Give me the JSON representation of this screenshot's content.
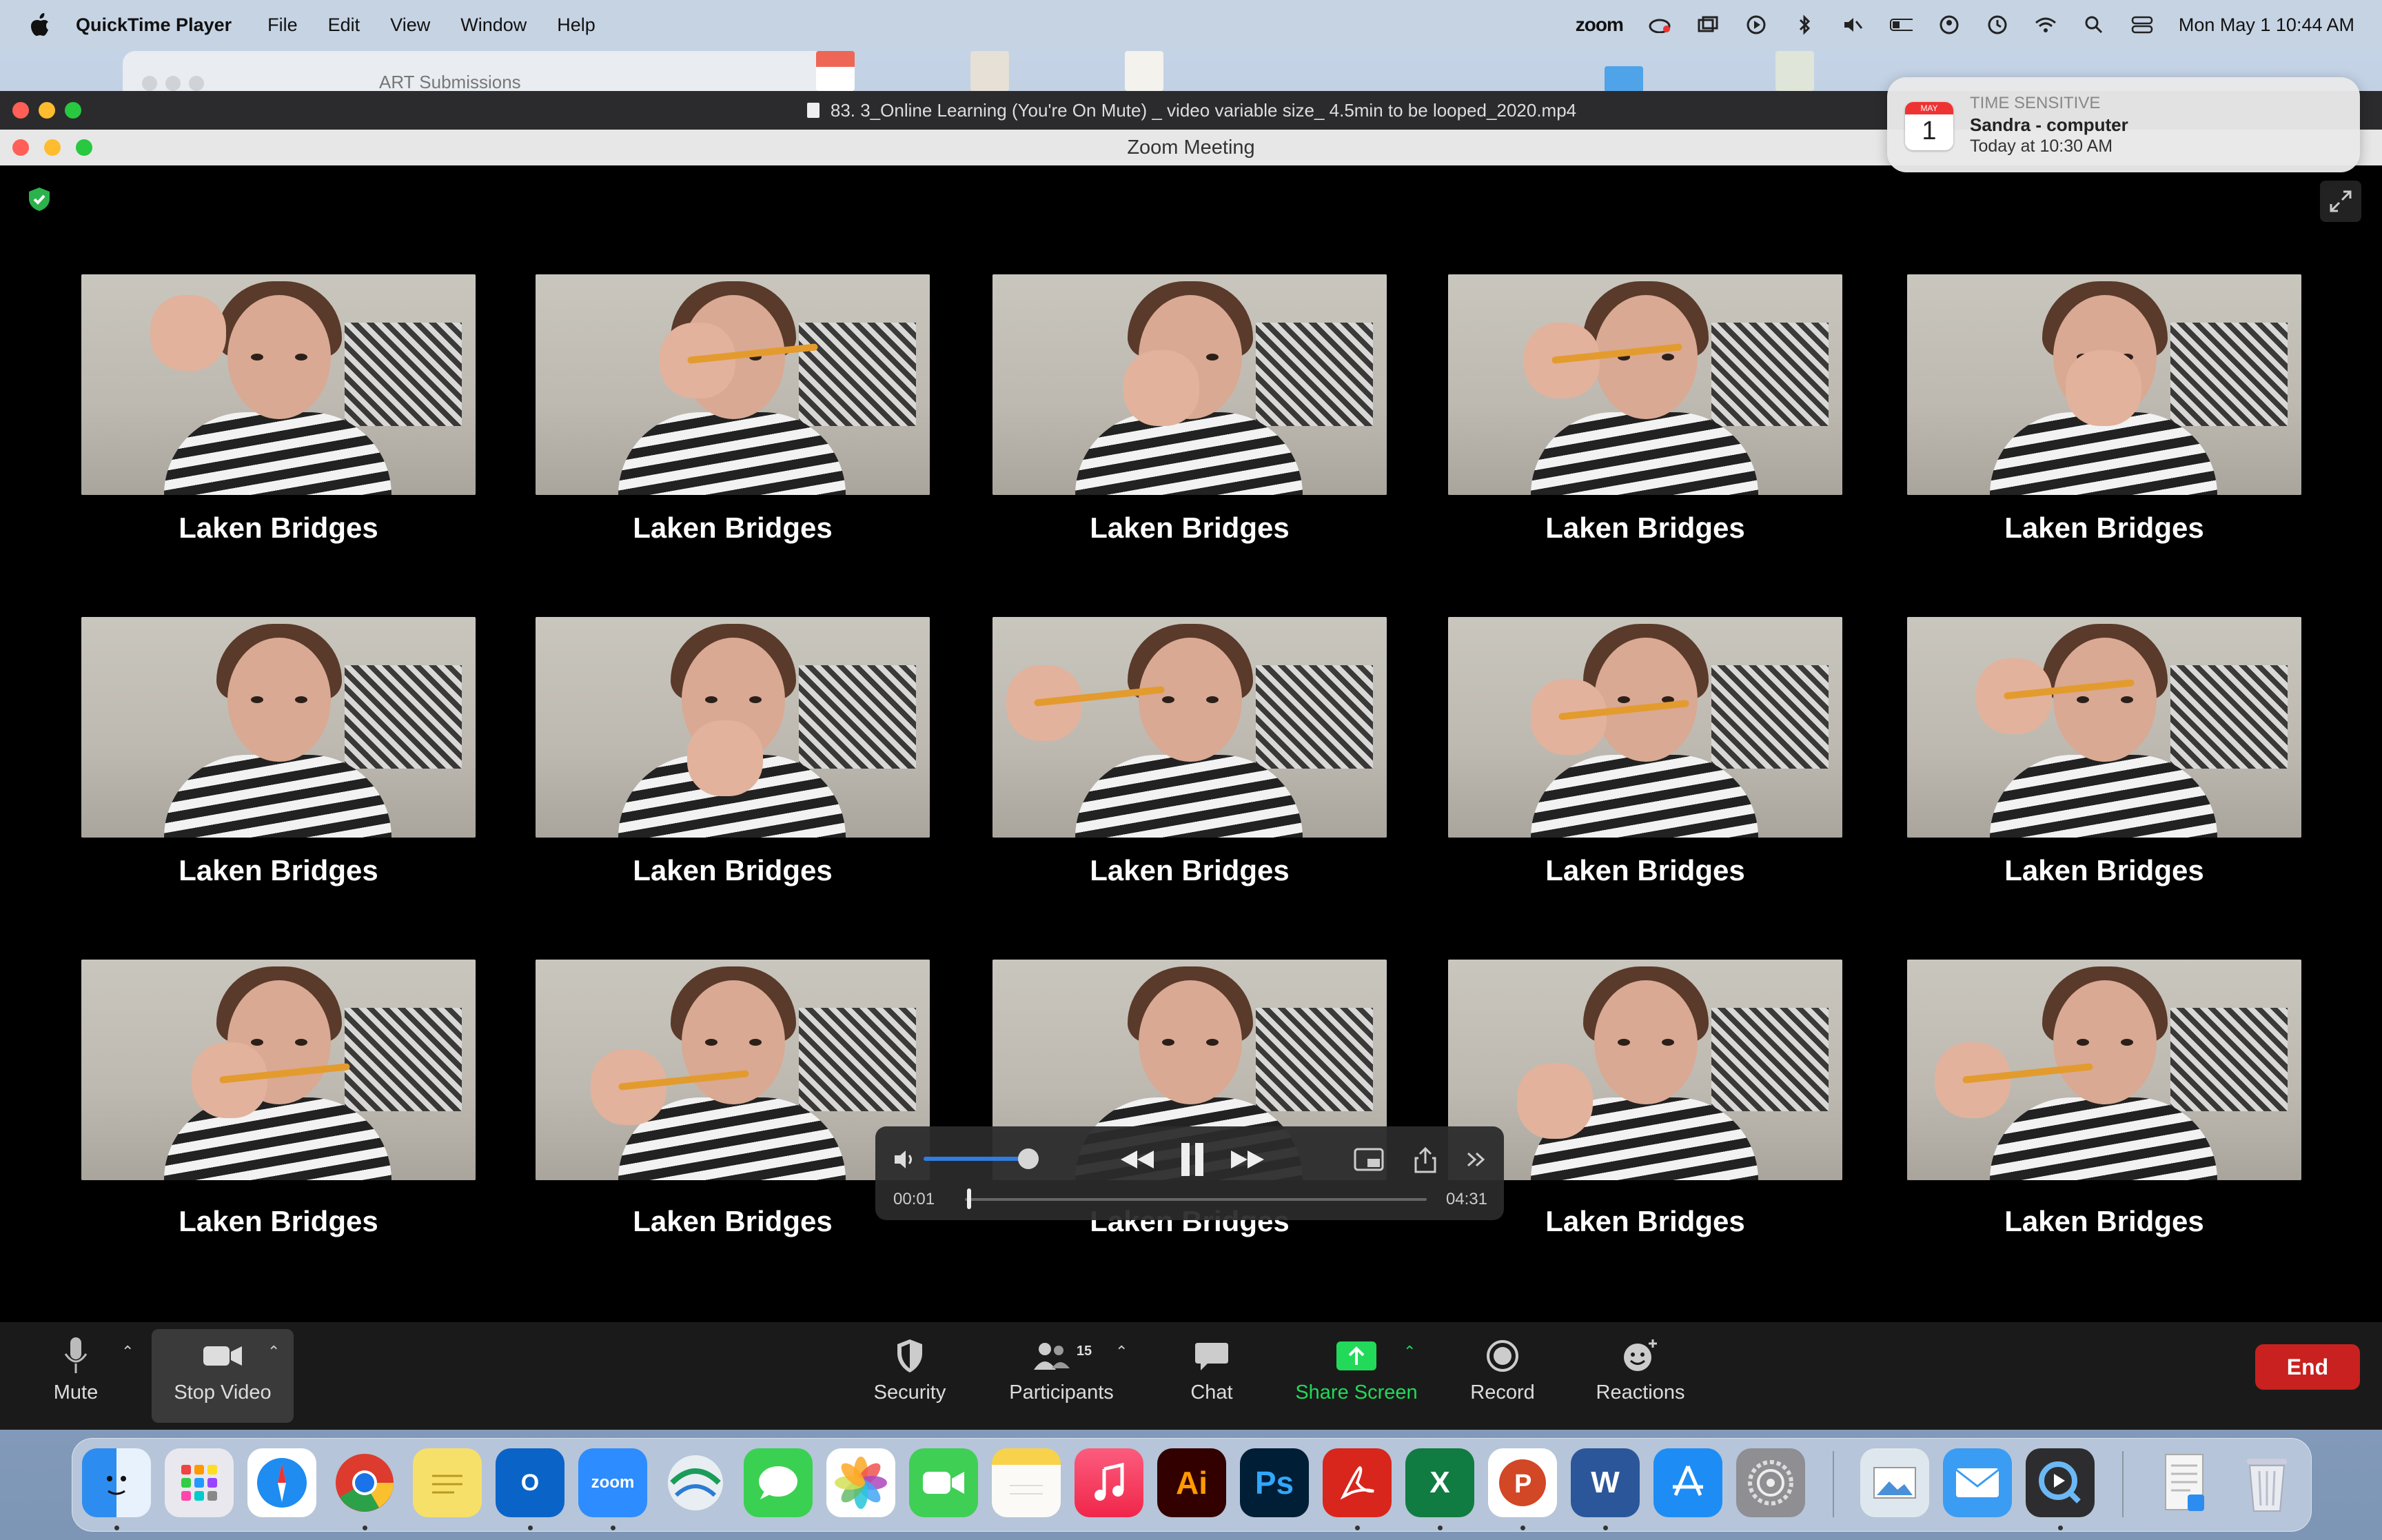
{
  "menubar": {
    "app_name": "QuickTime Player",
    "menus": [
      "File",
      "Edit",
      "View",
      "Window",
      "Help"
    ],
    "zoom_label": "zoom",
    "datetime": "Mon May 1  10:44 AM"
  },
  "background_window": {
    "title": "ART Submissions"
  },
  "quicktime": {
    "file_title": "83. 3_Online Learning (You're On Mute) _ video variable size_ 4.5min to be looped_2020.mp4",
    "time_elapsed": "00:01",
    "time_total": "04:31",
    "volume_level": 0.8,
    "progress_fraction": 0.004
  },
  "zoom": {
    "window_title": "Zoom Meeting",
    "participants": [
      {
        "name": "Laken Bridges"
      },
      {
        "name": "Laken Bridges"
      },
      {
        "name": "Laken Bridges"
      },
      {
        "name": "Laken Bridges"
      },
      {
        "name": "Laken Bridges"
      },
      {
        "name": "Laken Bridges"
      },
      {
        "name": "Laken Bridges"
      },
      {
        "name": "Laken Bridges"
      },
      {
        "name": "Laken Bridges"
      },
      {
        "name": "Laken Bridges"
      },
      {
        "name": "Laken Bridges"
      },
      {
        "name": "Laken Bridges"
      },
      {
        "name": "Laken Bridges"
      },
      {
        "name": "Laken Bridges"
      },
      {
        "name": "Laken Bridges"
      }
    ],
    "toolbar": {
      "mute": "Mute",
      "stop_video": "Stop Video",
      "security": "Security",
      "participants": "Participants",
      "participants_count": "15",
      "chat": "Chat",
      "share_screen": "Share Screen",
      "record": "Record",
      "reactions": "Reactions",
      "end": "End"
    },
    "colors": {
      "share_green": "#23d959",
      "end_red": "#c8211f",
      "shield_green": "#2bb24c"
    }
  },
  "notification": {
    "category": "TIME SENSITIVE",
    "title": "Sandra - computer",
    "subtitle": "Today at 10:30 AM",
    "cal_month": "MAY",
    "cal_day": "1"
  },
  "dock": {
    "zoom_label": "zoom",
    "ai_label": "Ai",
    "ps_label": "Ps",
    "word_label": "W",
    "excel_label": "X",
    "ppt_label": "P",
    "outlook_label": "O"
  }
}
